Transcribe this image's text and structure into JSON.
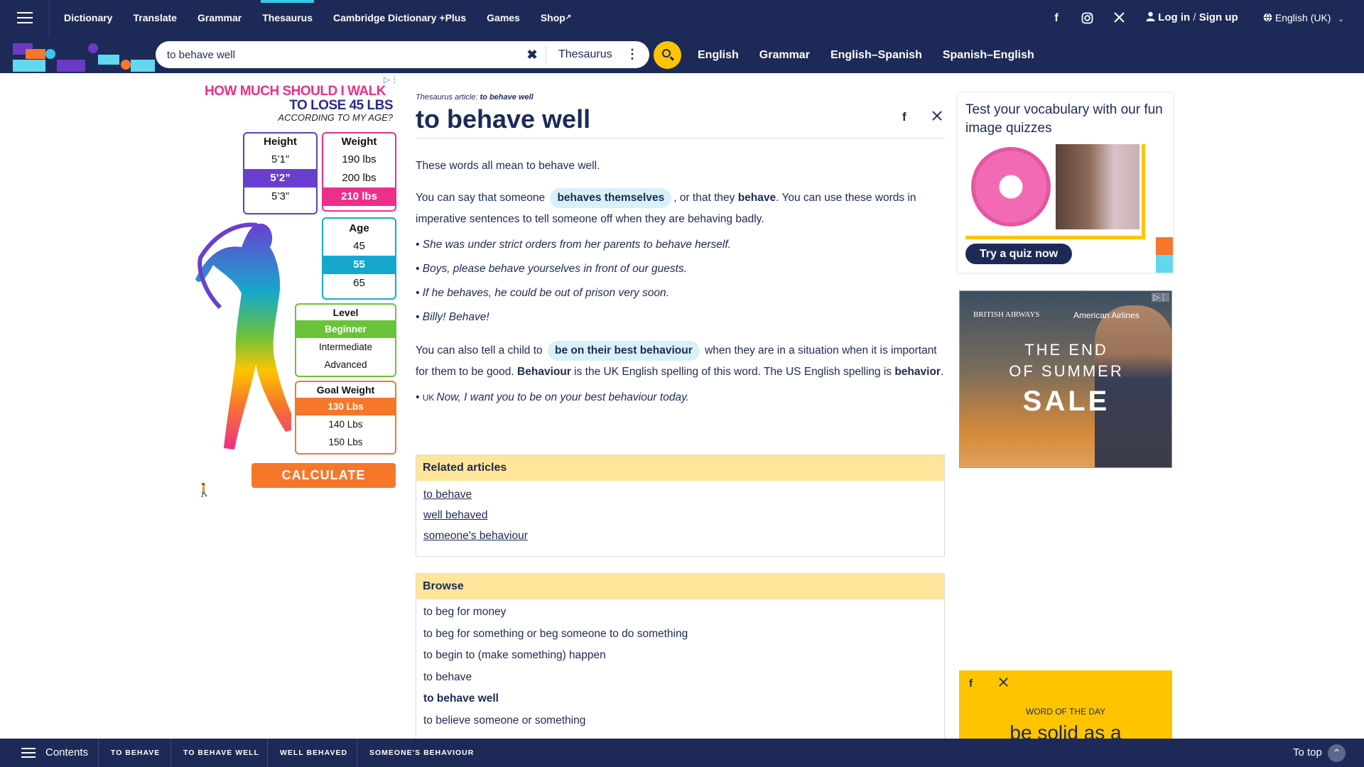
{
  "nav": {
    "links": [
      "Dictionary",
      "Translate",
      "Grammar",
      "Thesaurus",
      "Cambridge Dictionary +Plus",
      "Games",
      "Shop"
    ],
    "active": "Thesaurus",
    "login": "Log in",
    "signup": "Sign up",
    "login_sep": "/",
    "language": "English (UK)"
  },
  "search": {
    "query": "to behave well",
    "dictionary": "Thesaurus",
    "dictionaries": [
      "English",
      "Grammar",
      "English–Spanish",
      "Spanish–English"
    ]
  },
  "ad_left": {
    "line1": "HOW MUCH SHOULD I WALK",
    "line2": "TO LOSE 45 LBS",
    "line3": "ACCORDING TO MY AGE?",
    "height_label": "Height",
    "heights": [
      "5’1”",
      "5’2”",
      "5’3”"
    ],
    "weight_label": "Weight",
    "weights": [
      "190 lbs",
      "200 lbs",
      "210 lbs"
    ],
    "age_label": "Age",
    "ages": [
      "45",
      "55",
      "65"
    ],
    "level_label": "Level",
    "levels": [
      "Beginner",
      "Intermediate",
      "Advanced"
    ],
    "goal_label": "Goal Weight",
    "goals": [
      "130 Lbs",
      "140 Lbs",
      "150 Lbs"
    ],
    "cta": "CALCULATE"
  },
  "article": {
    "breadcrumb_prefix": "Thesaurus article:",
    "breadcrumb_term": "to behave well",
    "title": "to behave well",
    "intro": "These words all mean to behave well.",
    "p1_a": "You can say that someone",
    "p1_pill": "behaves themselves",
    "p1_b": ", or that they",
    "p1_bold": "behave",
    "p1_c": ". You can use these words in imperative sentences to tell someone off when they are behaving badly.",
    "examples1": [
      "She was under strict orders from her parents to behave herself.",
      "Boys, please behave yourselves in front of our guests.",
      "If he behaves, he could be out of prison very soon.",
      "Billy! Behave!"
    ],
    "p2_a": "You can also tell a child to",
    "p2_pill": "be on their best behaviour",
    "p2_b": "when they are in a situation when it is important for them to be good.",
    "p2_bold1": "Behaviour",
    "p2_c": "is the UK English spelling of this word. The US English spelling is",
    "p2_bold2": "behavior",
    "p2_d": ".",
    "example2_label": "UK",
    "example2": "Now, I want you to be on your best behaviour today."
  },
  "related": {
    "heading": "Related articles",
    "items": [
      "to behave",
      "well behaved",
      "someone's behaviour"
    ]
  },
  "browse": {
    "heading": "Browse",
    "items": [
      "to beg for money",
      "to beg for something or beg someone to do something",
      "to begin to (make something) happen",
      "to behave",
      "to behave well",
      "to believe someone or something"
    ],
    "current": "to behave well"
  },
  "quiz": {
    "title": "Test your vocabulary with our fun image quizzes",
    "button": "Try a quiz now"
  },
  "ad_right": {
    "brand1": "BRITISH AIRWAYS",
    "brand2": "American Airlines",
    "line1": "THE END",
    "line2": "OF SUMMER",
    "line3": "SALE"
  },
  "wotd": {
    "label": "WORD OF THE DAY",
    "word": "be solid as a"
  },
  "bottom": {
    "contents": "Contents",
    "links": [
      "TO BEHAVE",
      "TO BEHAVE WELL",
      "WELL BEHAVED",
      "SOMEONE'S BEHAVIOUR"
    ],
    "to_top": "To top"
  },
  "colors": {
    "navy": "#1d2a57",
    "yellow": "#fec400",
    "panel_header": "#fee599",
    "pill": "#d7f1f8",
    "accent_cyan": "#36c9e9"
  }
}
